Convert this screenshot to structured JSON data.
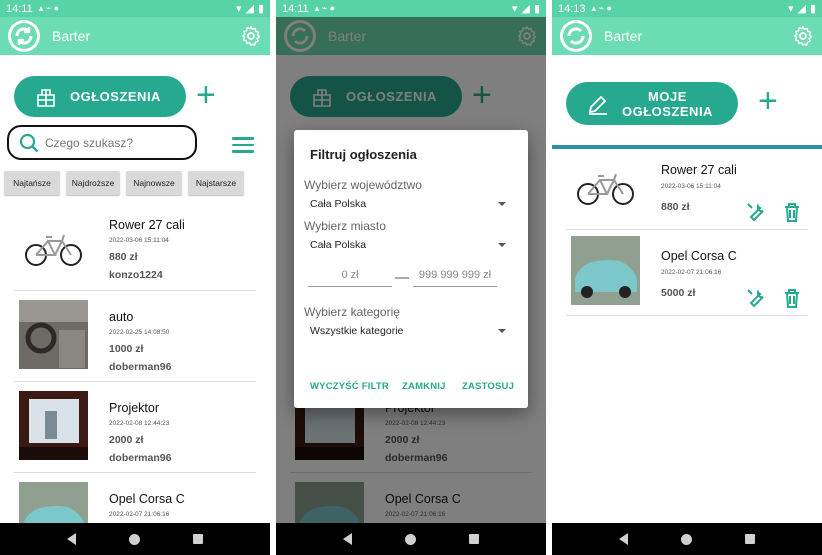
{
  "status": {
    "time1": "14:11",
    "time2": "14:11",
    "time3": "14:13"
  },
  "app": {
    "title": "Barter"
  },
  "screen1": {
    "ads_button": "OGŁOSZENIA",
    "search_placeholder": "Czego szukasz?",
    "sort": [
      "Najtańsze",
      "Najdroższe",
      "Najnowsze",
      "Najstarsze"
    ],
    "items": [
      {
        "title": "Rower 27 cali",
        "date": "2022-03-06 15:11:04",
        "price": "880 zł",
        "user": "konzo1224"
      },
      {
        "title": "auto",
        "date": "2022-02-25 14:08:50",
        "price": "1000 zł",
        "user": "doberman96"
      },
      {
        "title": "Projektor",
        "date": "2022-02-08 12:44:23",
        "price": "2000 zł",
        "user": "doberman96"
      },
      {
        "title": "Opel Corsa C",
        "date": "2022-02-07 21:06:16"
      }
    ]
  },
  "screen2": {
    "ads_button": "OGŁOSZENIA",
    "dialog": {
      "title": "Filtruj ogłoszenia",
      "voivodeship_label": "Wybierz województwo",
      "voivodeship_value": "Cała Polska",
      "city_label": "Wybierz miasto",
      "city_value": "Cała Polska",
      "price_min": "0 zł",
      "price_max": "999 999 999 zł",
      "category_label": "Wybierz kategorię",
      "category_value": "Wszystkie kategorie",
      "clear_button": "WYCZYŚĆ FILTR",
      "close_button": "ZAMKNIJ",
      "apply_button": "ZASTOSUJ"
    },
    "bg_items": [
      {
        "title": "Projektor",
        "date": "2022-02-08 12:44:23",
        "price": "2000 zł",
        "user": "doberman96"
      },
      {
        "title": "Opel Corsa C",
        "date": "2022-02-07 21:06:16"
      }
    ]
  },
  "screen3": {
    "my_ads_line1": "MOJE",
    "my_ads_line2": "OGŁOSZENIA",
    "items": [
      {
        "title": "Rower 27 cali",
        "date": "2022-03-06 15:11:04",
        "price": "880 zł"
      },
      {
        "title": "Opel Corsa C",
        "date": "2022-02-07 21:06:16",
        "price": "5000 zł"
      }
    ]
  },
  "colors": {
    "appbar": "#6cdcb4",
    "accent": "#26a98f"
  },
  "icons": [
    "refresh-logo-icon",
    "gear-icon",
    "search-icon",
    "menu-icon",
    "box-icon",
    "pencil-icon",
    "wrench-icon",
    "trash-icon",
    "plus-icon"
  ]
}
